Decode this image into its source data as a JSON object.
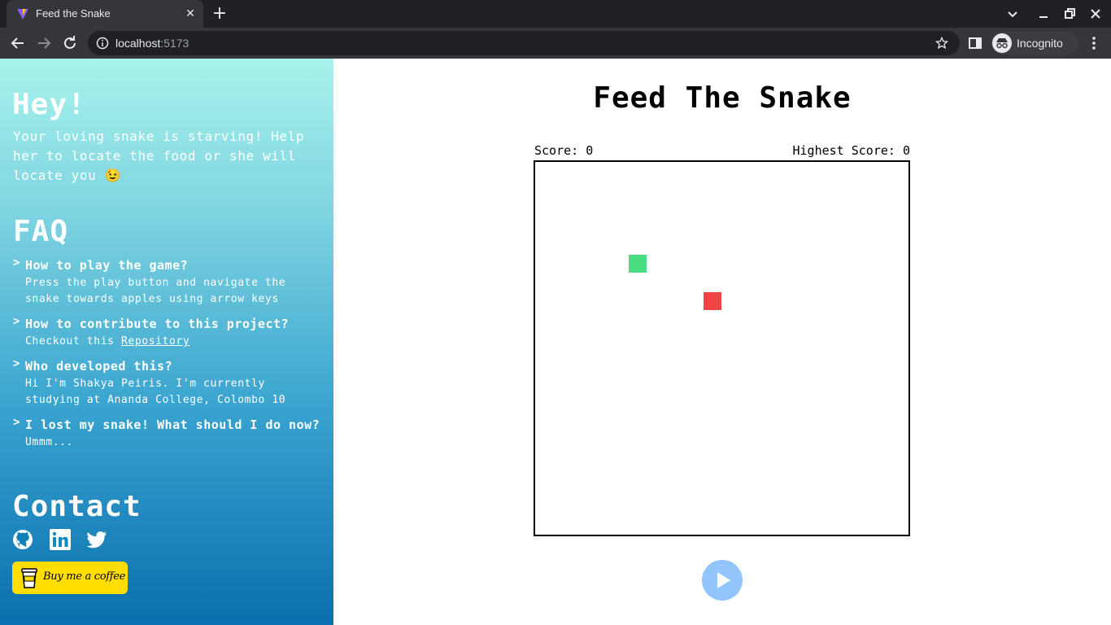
{
  "browser": {
    "tab_title": "Feed the Snake",
    "url_host": "localhost",
    "url_port": ":5173",
    "profile_label": "Incognito"
  },
  "sidebar": {
    "greeting": "Hey!",
    "intro": "Your loving snake is starving! Help her to locate the food or she will locate you 😉",
    "faq_title": "FAQ",
    "faq": [
      {
        "question": "How to play the game?",
        "answer": "Press the play button and navigate the snake towards apples using arrow keys"
      },
      {
        "question": "How to contribute to this project?",
        "answer_prefix": "Checkout this ",
        "link_text": "Repository"
      },
      {
        "question": "Who developed this?",
        "answer": "Hi I'm Shakya Peiris. I'm currently studying at Ananda College, Colombo 10"
      },
      {
        "question": "I lost my snake! What should I do now?",
        "answer": "Ummm..."
      }
    ],
    "faq_arrow": ">",
    "contact_title": "Contact",
    "socials": [
      "github-icon",
      "linkedin-icon",
      "twitter-icon"
    ],
    "coffee_label": "Buy me a coffee"
  },
  "game": {
    "title": "Feed The Snake",
    "score_label": "Score: 0",
    "highest_score_label": "Highest Score: 0",
    "snake_color": "#4ade80",
    "food_color": "#ef4444",
    "play_button_color": "#93c5fd"
  }
}
